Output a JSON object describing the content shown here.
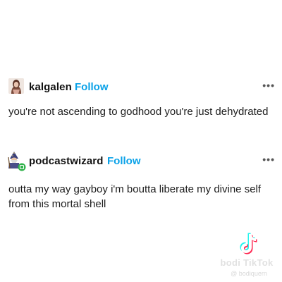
{
  "posts": [
    {
      "username": "kalgalen",
      "follow_label": "Follow",
      "more_label": "•••",
      "text": "you're not ascending to godhood you're just dehydrated",
      "avatar_icon": "user-photo-avatar"
    },
    {
      "username": "podcastwizard",
      "follow_label": "Follow",
      "more_label": "•••",
      "text": "outta my way gayboy i'm boutta liberate my divine self from this mortal shell",
      "avatar_icon": "wizard-avatar"
    }
  ],
  "watermark": {
    "logo_icon": "tiktok-logo-icon",
    "brand": "bodi TikTok",
    "handle": "@ bodiquern"
  },
  "colors": {
    "follow": "#0aa2e8",
    "text": "#1c1c1c",
    "background": "#ffffff"
  }
}
